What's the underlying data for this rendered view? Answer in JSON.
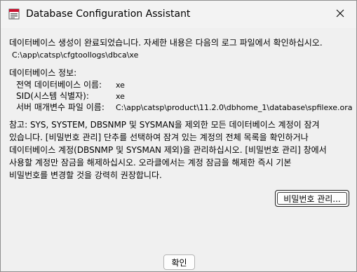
{
  "window": {
    "title": "Database Configuration Assistant"
  },
  "message": {
    "completed_line": "데이터베이스 생성이 완료되었습니다. 자세한 내용은 다음의 로그 파일에서 확인하십시오.",
    "log_path": "C:\\app\\catsp\\cfgtoollogs\\dbca\\xe"
  },
  "db_info": {
    "heading": "데이터베이스 정보:",
    "rows": [
      {
        "label": "전역 데이터베이스 이름:",
        "value": "xe"
      },
      {
        "label": "SID(시스템 식별자):",
        "value": "xe"
      },
      {
        "label": "서버 매개변수 파일 이름:",
        "value": "C:\\app\\catsp\\product\\11.2.0\\dbhome_1\\database\\spfilexe.ora"
      }
    ]
  },
  "note": {
    "lines": [
      "참고: SYS, SYSTEM, DBSNMP 및 SYSMAN을 제외한 모든 데이터베이스 계정이 잠겨",
      "있습니다. [비밀번호 관리] 단추를 선택하여 잠겨 있는 계정의 전체 목록을 확인하거나",
      "데이터베이스 계정(DBSNMP 및 SYSMAN 제외)을 관리하십시오. [비밀번호 관리] 창에서",
      "사용할 계정만 잠금을 해제하십시오. 오라클에서는 계정 잠금을 해제한 즉시 기본",
      "비밀번호를 변경할 것을 강력히 권장합니다."
    ]
  },
  "buttons": {
    "password_management": "비밀번호 관리...",
    "ok": "확인"
  },
  "icons": {
    "app": "oracle-app-icon",
    "close": "close-icon"
  },
  "colors": {
    "window_bg": "#f0f0f0",
    "titlebar_bg": "#f3f3f3",
    "border": "#8e8e8e"
  }
}
